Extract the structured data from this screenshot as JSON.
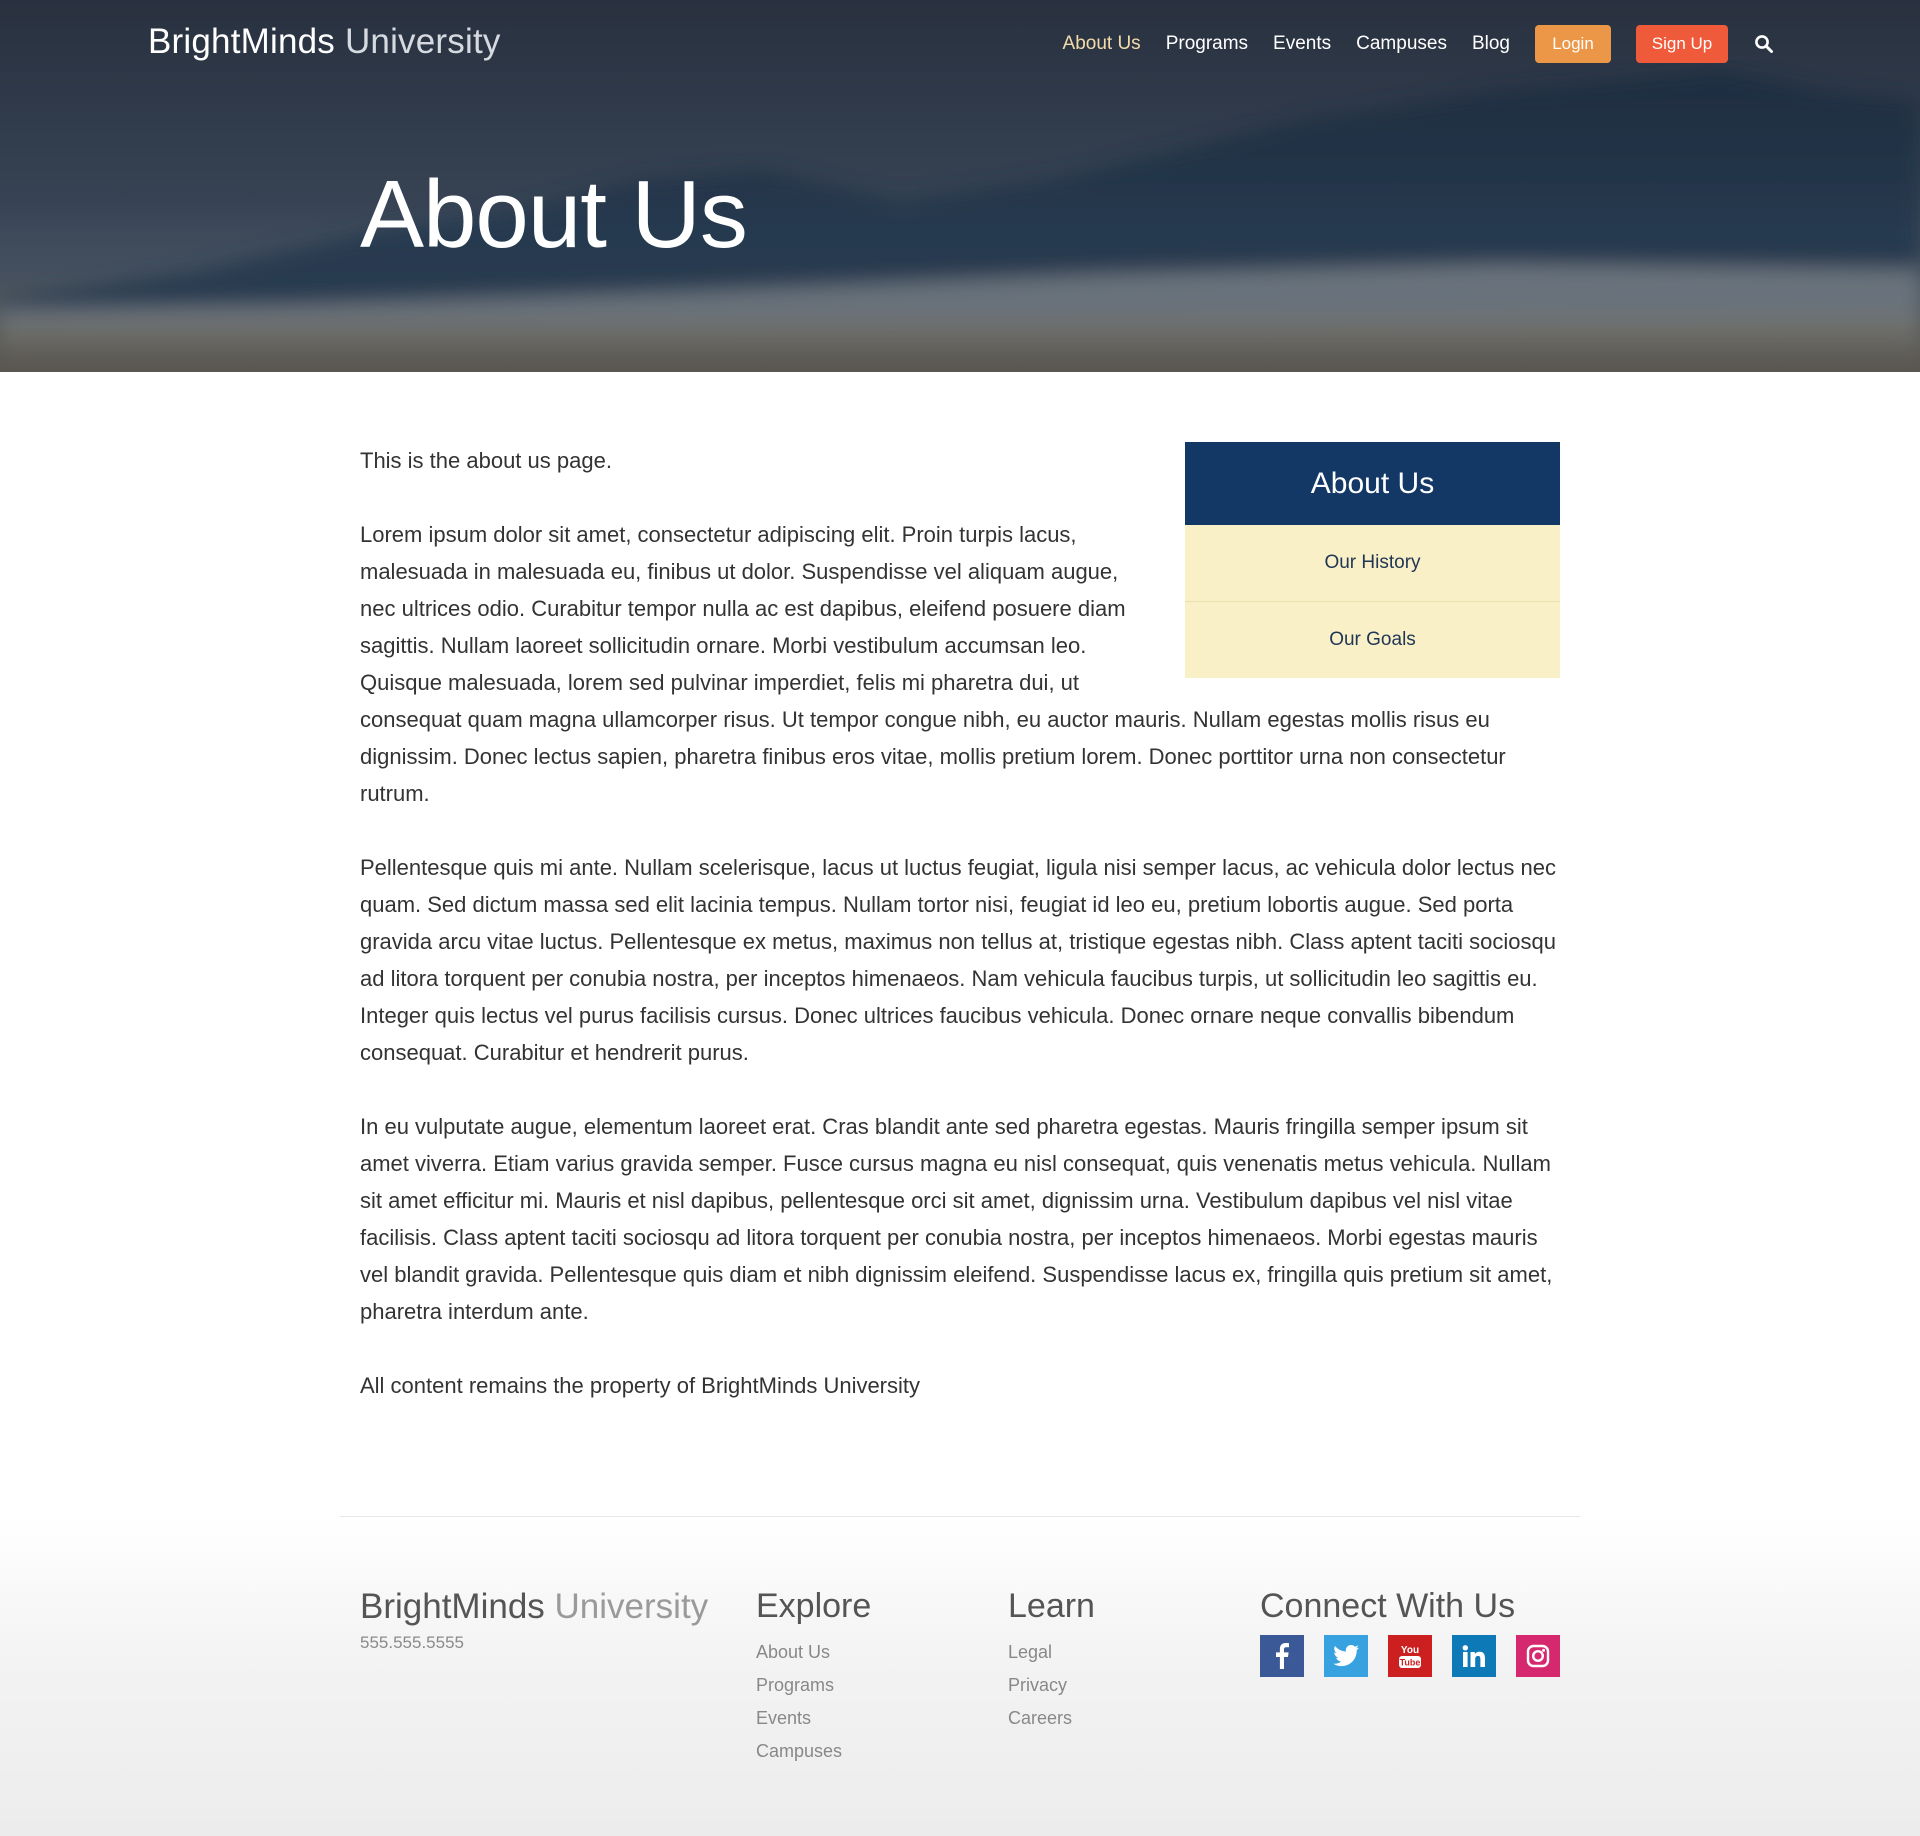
{
  "header": {
    "brand_bold": "BrightMinds",
    "brand_light": "University",
    "nav": [
      {
        "label": "About Us",
        "active": true
      },
      {
        "label": "Programs"
      },
      {
        "label": "Events"
      },
      {
        "label": "Campuses"
      },
      {
        "label": "Blog"
      }
    ],
    "login_label": "Login",
    "signup_label": "Sign Up",
    "search_icon": "search-icon"
  },
  "hero": {
    "title": "About Us"
  },
  "content": {
    "paragraphs": [
      "This is the about us page.",
      "Lorem ipsum dolor sit amet, consectetur adipiscing elit. Proin turpis lacus, malesuada in malesuada eu, finibus ut dolor. Suspendisse vel aliquam augue, nec ultrices odio. Curabitur tempor nulla ac est dapibus, eleifend posuere diam sagittis. Nullam laoreet sollicitudin ornare. Morbi vestibulum accumsan leo. Quisque malesuada, lorem sed pulvinar imperdiet, felis mi pharetra dui, ut consequat quam magna ullamcorper risus. Ut tempor congue nibh, eu auctor mauris. Nullam egestas mollis risus eu dignissim. Donec lectus sapien, pharetra finibus eros vitae, mollis pretium lorem. Donec porttitor urna non consectetur rutrum.",
      "Pellentesque quis mi ante. Nullam scelerisque, lacus ut luctus feugiat, ligula nisi semper lacus, ac vehicula dolor lectus nec quam. Sed dictum massa sed elit lacinia tempus. Nullam tortor nisi, feugiat id leo eu, pretium lobortis augue. Sed porta gravida arcu vitae luctus. Pellentesque ex metus, maximus non tellus at, tristique egestas nibh. Class aptent taciti sociosqu ad litora torquent per conubia nostra, per inceptos himenaeos. Nam vehicula faucibus turpis, ut sollicitudin leo sagittis eu. Integer quis lectus vel purus facilisis cursus. Donec ultrices faucibus vehicula. Donec ornare neque convallis bibendum consequat. Curabitur et hendrerit purus.",
      "In eu vulputate augue, elementum laoreet erat. Cras blandit ante sed pharetra egestas. Mauris fringilla semper ipsum sit amet viverra. Etiam varius gravida semper. Fusce cursus magna eu nisl consequat, quis venenatis metus vehicula. Nullam sit amet efficitur mi. Mauris et nisl dapibus, pellentesque orci sit amet, dignissim urna. Vestibulum dapibus vel nisl vitae facilisis. Class aptent taciti sociosqu ad litora torquent per conubia nostra, per inceptos himenaeos. Morbi egestas mauris vel blandit gravida. Pellentesque quis diam et nibh dignissim eleifend. Suspendisse lacus ex, fringilla quis pretium sit amet, pharetra interdum ante.",
      "All content remains the property of BrightMinds University"
    ]
  },
  "sidebar": {
    "title": "About Us",
    "items": [
      {
        "label": "Our History"
      },
      {
        "label": "Our Goals"
      }
    ]
  },
  "footer": {
    "brand_bold": "BrightMinds",
    "brand_light": "University",
    "phone": "555.555.5555",
    "explore": {
      "heading": "Explore",
      "links": [
        "About Us",
        "Programs",
        "Events",
        "Campuses"
      ]
    },
    "learn": {
      "heading": "Learn",
      "links": [
        "Legal",
        "Privacy",
        "Careers"
      ]
    },
    "connect": {
      "heading": "Connect With Us",
      "socials": [
        {
          "icon": "facebook-icon",
          "color": "#3b5897"
        },
        {
          "icon": "twitter-icon",
          "color": "#38a1e0"
        },
        {
          "icon": "youtube-icon",
          "color": "#cc1f20"
        },
        {
          "icon": "linkedin-icon",
          "color": "#0d79b7"
        },
        {
          "icon": "instagram-icon",
          "color": "#d6286f"
        }
      ]
    }
  },
  "colors": {
    "nav_active": "#f4dcaa",
    "login_button": "#ec9647",
    "signup_button": "#ef5a3a",
    "sidebar_header": "#133866",
    "sidebar_item": "#faf0c8"
  }
}
